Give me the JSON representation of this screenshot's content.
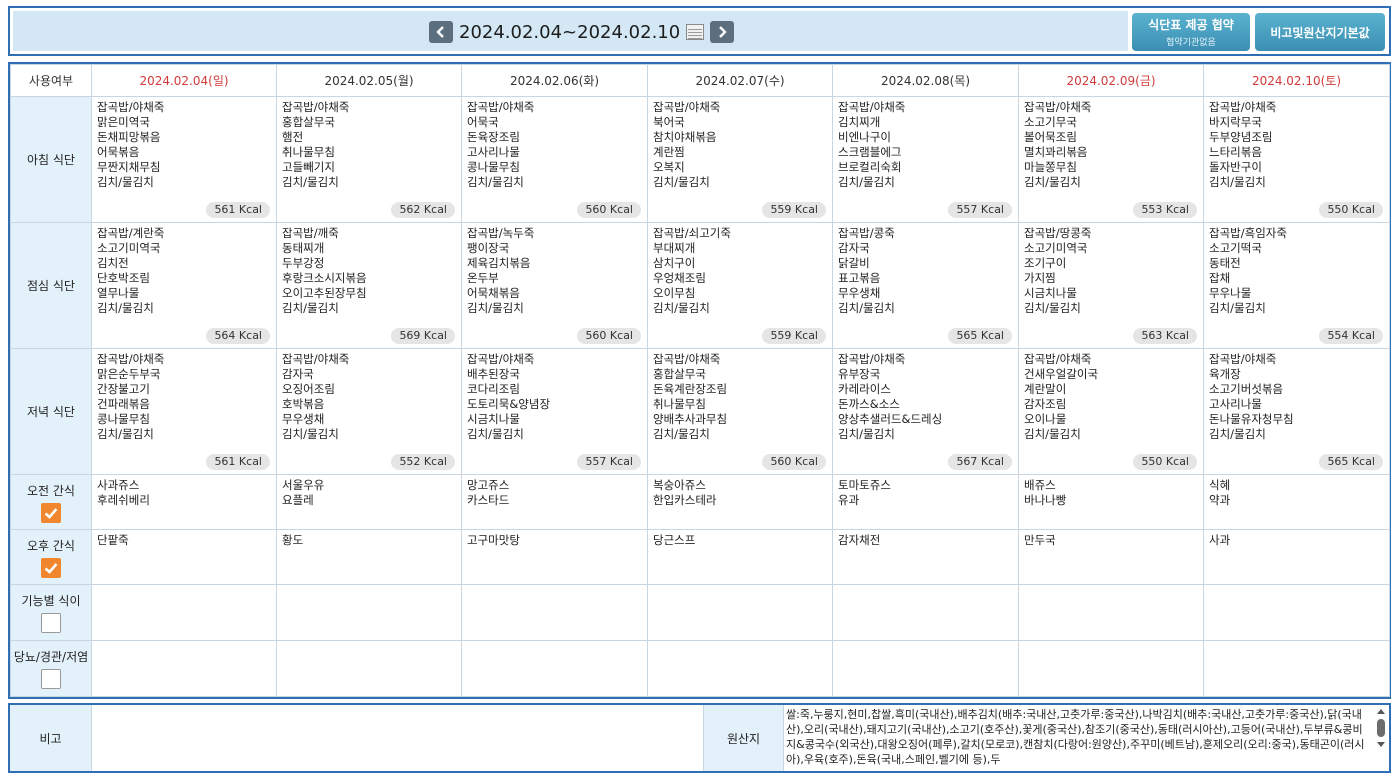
{
  "header": {
    "date_range": "2024.02.04~2024.02.10",
    "prev_icon": "chevron-left-icon",
    "next_icon": "chevron-right-icon",
    "calendar_icon": "calendar-icon",
    "btn_agreement": "식단표 제공 협약",
    "btn_agreement_sub": "협약기관없음",
    "btn_origin": "비고및원산지기본값"
  },
  "table": {
    "corner": "사용여부",
    "days": [
      {
        "label": "2024.02.04(일)",
        "red": true
      },
      {
        "label": "2024.02.05(월)",
        "red": false
      },
      {
        "label": "2024.02.06(화)",
        "red": false
      },
      {
        "label": "2024.02.07(수)",
        "red": false
      },
      {
        "label": "2024.02.08(목)",
        "red": false
      },
      {
        "label": "2024.02.09(금)",
        "red": true
      },
      {
        "label": "2024.02.10(토)",
        "red": true
      }
    ],
    "rows": {
      "breakfast": {
        "label": "아침 식단",
        "cells": [
          {
            "items": [
              "잡곡밥/야채죽",
              "맑은미역국",
              "돈채피망볶음",
              "어묵볶음",
              "무짠지채무침",
              "김치/물김치"
            ],
            "kcal": "561 Kcal"
          },
          {
            "items": [
              "잡곡밥/야채죽",
              "홍합살무국",
              "햄전",
              "취나물무침",
              "고들빼기지",
              "김치/물김치"
            ],
            "kcal": "562 Kcal"
          },
          {
            "items": [
              "잡곡밥/야채죽",
              "어묵국",
              "돈육장조림",
              "고사리나물",
              "콩나물무침",
              "김치/물김치"
            ],
            "kcal": "560 Kcal"
          },
          {
            "items": [
              "잡곡밥/야채죽",
              "북어국",
              "참치야채볶음",
              "계란찜",
              "오복지",
              "김치/물김치"
            ],
            "kcal": "559 Kcal"
          },
          {
            "items": [
              "잡곡밥/야채죽",
              "김치찌개",
              "비엔나구이",
              "스크램블에그",
              "브로컬리숙회",
              "김치/물김치"
            ],
            "kcal": "557 Kcal"
          },
          {
            "items": [
              "잡곡밥/야채죽",
              "소고기무국",
              "볼어묵조림",
              "멸치꽈리볶음",
              "마늘쫑무침",
              "김치/물김치"
            ],
            "kcal": "553 Kcal"
          },
          {
            "items": [
              "잡곡밥/야채죽",
              "바지락무국",
              "두부양념조림",
              "느타리볶음",
              "돌자반구이",
              "김치/물김치"
            ],
            "kcal": "550 Kcal"
          }
        ]
      },
      "lunch": {
        "label": "점심 식단",
        "cells": [
          {
            "items": [
              "잡곡밥/계란죽",
              "소고기미역국",
              "김치전",
              "단호박조림",
              "열무나물",
              "김치/물김치"
            ],
            "kcal": "564 Kcal"
          },
          {
            "items": [
              "잡곡밥/깨죽",
              "동태찌개",
              "두부강정",
              "후랑크소시지볶음",
              "오이고추된장무침",
              "김치/물김치"
            ],
            "kcal": "569 Kcal"
          },
          {
            "items": [
              "잡곡밥/녹두죽",
              "팽이장국",
              "제육김치볶음",
              "온두부",
              "어묵채볶음",
              "김치/물김치"
            ],
            "kcal": "560 Kcal"
          },
          {
            "items": [
              "잡곡밥/쇠고기죽",
              "부대찌개",
              "삼치구이",
              "우엉채조림",
              "오이무침",
              "김치/물김치"
            ],
            "kcal": "559 Kcal"
          },
          {
            "items": [
              "잡곡밥/콩죽",
              "감자국",
              "닭갈비",
              "표고볶음",
              "무우생채",
              "김치/물김치"
            ],
            "kcal": "565 Kcal"
          },
          {
            "items": [
              "잡곡밥/땅콩죽",
              "소고기미역국",
              "조기구이",
              "가지찜",
              "시금치나물",
              "김치/물김치"
            ],
            "kcal": "563 Kcal"
          },
          {
            "items": [
              "잡곡밥/흑임자죽",
              "소고기떡국",
              "동태전",
              "잡채",
              "무우나물",
              "김치/물김치"
            ],
            "kcal": "554 Kcal"
          }
        ]
      },
      "dinner": {
        "label": "저녁 식단",
        "cells": [
          {
            "items": [
              "잡곡밥/야채죽",
              "맑은순두부국",
              "간장불고기",
              "건파래볶음",
              "콩나물무침",
              "김치/물김치"
            ],
            "kcal": "561 Kcal"
          },
          {
            "items": [
              "잡곡밥/야채죽",
              "감자국",
              "오징어조림",
              "호박볶음",
              "무우생채",
              "김치/물김치"
            ],
            "kcal": "552 Kcal"
          },
          {
            "items": [
              "잡곡밥/야채죽",
              "배추된장국",
              "코다리조림",
              "도토리묵&양념장",
              "시금치나물",
              "김치/물김치"
            ],
            "kcal": "557 Kcal"
          },
          {
            "items": [
              "잡곡밥/야채죽",
              "홍합살무국",
              "돈육계란장조림",
              "취나물무침",
              "양배추사과무침",
              "김치/물김치"
            ],
            "kcal": "560 Kcal"
          },
          {
            "items": [
              "잡곡밥/야채죽",
              "유부장국",
              "카레라이스",
              "돈까스&소스",
              "양상추샐러드&드레싱",
              "김치/물김치"
            ],
            "kcal": "567 Kcal"
          },
          {
            "items": [
              "잡곡밥/야채죽",
              "건새우얼갈이국",
              "계란말이",
              "감자조림",
              "오이나물",
              "김치/물김치"
            ],
            "kcal": "550 Kcal"
          },
          {
            "items": [
              "잡곡밥/야채죽",
              "육개장",
              "소고기버섯볶음",
              "고사리나물",
              "돈나물유자청무침",
              "김치/물김치"
            ],
            "kcal": "565 Kcal"
          }
        ]
      },
      "am_snack": {
        "label": "오전 간식",
        "checked": true,
        "cells": [
          {
            "items": [
              "사과쥬스",
              "후레쉬베리"
            ]
          },
          {
            "items": [
              "서울우유",
              "요플레"
            ]
          },
          {
            "items": [
              "망고쥬스",
              "카스타드"
            ]
          },
          {
            "items": [
              "복숭아쥬스",
              "한입카스테라"
            ]
          },
          {
            "items": [
              "토마토쥬스",
              "유과"
            ]
          },
          {
            "items": [
              "배쥬스",
              "바나나빵"
            ]
          },
          {
            "items": [
              "식혜",
              "약과"
            ]
          }
        ]
      },
      "pm_snack": {
        "label": "오후 간식",
        "checked": true,
        "cells": [
          {
            "items": [
              "단팥죽"
            ]
          },
          {
            "items": [
              "황도"
            ]
          },
          {
            "items": [
              "고구마맛탕"
            ]
          },
          {
            "items": [
              "당근스프"
            ]
          },
          {
            "items": [
              "감자채전"
            ]
          },
          {
            "items": [
              "만두국"
            ]
          },
          {
            "items": [
              "사과"
            ]
          }
        ]
      },
      "functional": {
        "label": "기능별 식이",
        "checked": false,
        "cells": [
          {
            "items": []
          },
          {
            "items": []
          },
          {
            "items": []
          },
          {
            "items": []
          },
          {
            "items": []
          },
          {
            "items": []
          },
          {
            "items": []
          }
        ]
      },
      "diabetic": {
        "label": "당뇨/경관/저염",
        "checked": false,
        "cells": [
          {
            "items": []
          },
          {
            "items": []
          },
          {
            "items": []
          },
          {
            "items": []
          },
          {
            "items": []
          },
          {
            "items": []
          },
          {
            "items": []
          }
        ]
      }
    }
  },
  "bottom": {
    "note_label": "비고",
    "note_text": "",
    "origin_label": "원산지",
    "origin_text": "쌀:죽,누룽지,현미,찹쌀,흑미(국내산),배추김치(배추:국내산,고춧가루:중국산),나박김치(배추:국내산,고춧가루:중국산),닭(국내산),오리(국내산),돼지고기(국내산),소고기(호주산),꽃게(중국산),참조기(중국산),동태(러시아산),고등어(국내산),두부류&콩비지&콩국수(외국산),대왕오징어(페루),갈치(모로코),캔참치(다랑어:원양산),주꾸미(베트남),훈제오리(오리:중국),동태곤이(러시아),우육(호주),돈육(국내,스페인,벨기에 등),두"
  }
}
